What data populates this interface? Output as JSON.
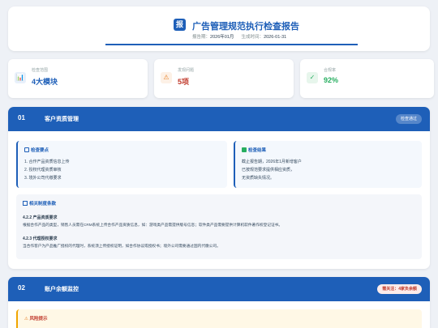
{
  "header": {
    "logo_text": "报",
    "title": "广告管理规范执行检查报告",
    "period_label": "报告期：",
    "period_value": "2026年01月",
    "generated_label": "生成时间：",
    "generated_value": "2026-01-31"
  },
  "stats": [
    {
      "label": "检查范围",
      "value": "4大模块",
      "icon": "chart-icon",
      "icon_glyph": "📊",
      "color": "#1e5fb8"
    },
    {
      "label": "发现问题",
      "value": "5项",
      "icon": "warning-icon",
      "icon_glyph": "⚠",
      "color": "#c0392b"
    },
    {
      "label": "合规率",
      "value": "92%",
      "icon": "check-icon",
      "icon_glyph": "✓",
      "color": "#27ae60"
    }
  ],
  "section1": {
    "number": "01",
    "title": "客户资质管理",
    "badge": "检查通过",
    "points": {
      "title": "检查要点",
      "items": [
        "1. 合作产品资质信息上传",
        "2. 授权代理资质审核",
        "3. 境外公司代缴要求"
      ]
    },
    "results": {
      "title": "检查结果",
      "items": [
        "截止报告期，2026年1月新增客户",
        "已按规范要求提供相应资质，",
        "无资质缺失情况。"
      ]
    },
    "rules": {
      "title": "相关制度条款",
      "items": [
        {
          "name": "4.2.2 产品资质要求",
          "desc": "根据合作产品的类型，销售人员需在CRM系统上传合作产品资质信息，如：游戏类产品需提供版号信息；软件类产品需要提供计算机软件著作权登记证书。"
        },
        {
          "name": "4.2.3 代理授权要求",
          "desc": "当合作客户为产品推广授权的代理时，系统须上传授权证明，如合作协议或授权书；境外公司需要通过国内代缴公司。"
        }
      ]
    }
  },
  "section2": {
    "number": "02",
    "title": "账户余额监控",
    "badge": "需关注：4家负余额",
    "alert_title": "风险提示"
  }
}
